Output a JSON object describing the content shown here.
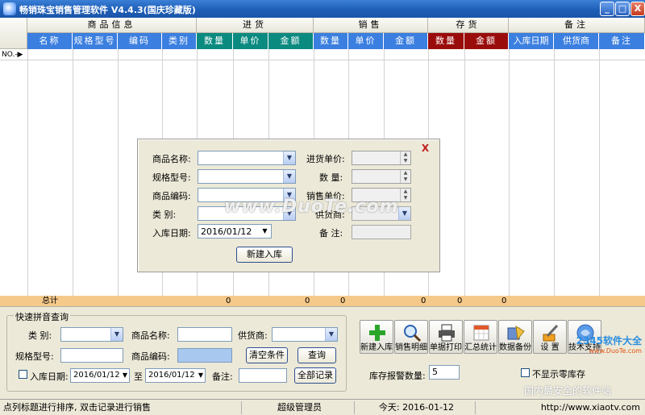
{
  "window": {
    "title": "畅销珠宝销售管理软件 V4.4.3(国庆珍藏版)",
    "minimize": "_",
    "maximize": "□",
    "close": "X"
  },
  "grid": {
    "groups": [
      "商品信息",
      "进货",
      "销售",
      "存货",
      "备注"
    ],
    "columns": [
      "名称",
      "规格型号",
      "编码",
      "类别",
      "数量",
      "单价",
      "金额",
      "数量",
      "单价",
      "金额",
      "数量",
      "金额",
      "入库日期",
      "供货商",
      "备注"
    ],
    "row_marker": "NO.-▶",
    "total_label": "总计",
    "totals": [
      "0",
      "0",
      "0",
      "0",
      "0",
      "0"
    ]
  },
  "dialog": {
    "close": "X",
    "name_label": "商品名称:",
    "spec_label": "规格型号:",
    "code_label": "商品编码:",
    "category_label": "类    别:",
    "date_label": "入库日期:",
    "date_value": "2016/01/12",
    "purchase_price_label": "进货单价:",
    "qty_label": "数    量:",
    "sale_price_label": "销售单价:",
    "supplier_label": "供货商:",
    "note_label": "备    注:",
    "submit": "新建入库"
  },
  "watermark": "www.DuoTe.com",
  "query": {
    "legend": "快速拼音查询",
    "category_label": "类  别:",
    "name_label": "商品名称:",
    "supplier_label": "供货商:",
    "spec_label": "规格型号:",
    "code_label": "商品编码:",
    "clear": "清空条件",
    "search": "查询",
    "date_label": "入库日期:",
    "date_from": "2016/01/12",
    "to": "至",
    "date_to": "2016/01/12",
    "note_label": "备注:",
    "all": "全部记录"
  },
  "toolbar": {
    "new_in": "新建入库",
    "sale_detail": "销售明细",
    "print": "单据打印",
    "summary": "汇总统计",
    "backup": "数据备份",
    "settings": "设 置",
    "support": "技术支持"
  },
  "stock_alert": {
    "label": "库存报警数量:",
    "value": "5"
  },
  "hide_zero": {
    "label": "不显示零库存"
  },
  "logo": {
    "main": "2345软件大全",
    "sub": "www.DuoTe.com"
  },
  "safe_banner": "国内最安全的软件站",
  "status": {
    "hint": "点列标题进行排序, 双击记录进行销售",
    "user": "超级管理员",
    "today": "今天: 2016-01-12",
    "site": "http://www.xiaotv.com"
  }
}
